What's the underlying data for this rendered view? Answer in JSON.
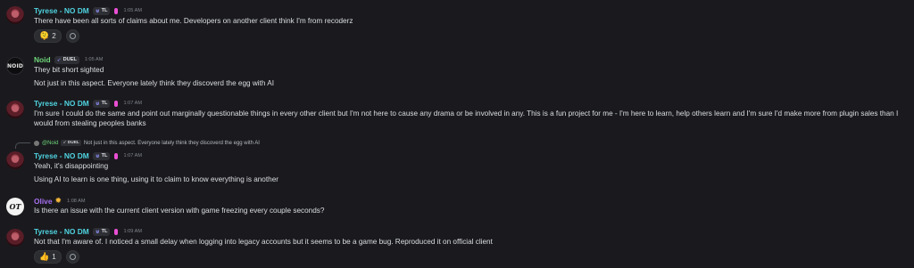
{
  "messages": [
    {
      "author": "Tyrese - NO DM",
      "tag": "TL",
      "time": "1:05 AM",
      "lines": [
        "There have been all sorts of claims about me. Developers on another client think I'm from recoderz"
      ],
      "reactions": [
        {
          "emoji": "🫠",
          "count": "2"
        }
      ]
    },
    {
      "author": "Noid",
      "avatar_text": "NOID",
      "tag": "DUEL",
      "time": "1:05 AM",
      "lines": [
        "They bit short sighted",
        "Not just in this aspect. Everyone lately think they discoverd the egg with AI"
      ]
    },
    {
      "author": "Tyrese - NO DM",
      "tag": "TL",
      "time": "1:07 AM",
      "lines": [
        "I'm sure I could do the same and point out marginally questionable things in every other client but I'm not here to cause any drama or be involved in any. This is a fun project for me - I'm here to learn, help others learn and I'm sure I'd make more from plugin sales than I would from stealing peoples banks"
      ]
    },
    {
      "reply": {
        "name": "@Noid",
        "tag": "DUEL",
        "text": "Not just in this aspect. Everyone lately think they discoverd the egg with AI"
      },
      "author": "Tyrese - NO DM",
      "tag": "TL",
      "time": "1:07 AM",
      "lines": [
        "Yeah, it's disappointing",
        "Using AI to learn is one thing, using it to claim to know everything is another"
      ]
    },
    {
      "author": "Olive",
      "avatar_text": "OT",
      "time": "1:08 AM",
      "lines": [
        "Is there an issue with the current client version with game freezing every couple seconds?"
      ]
    },
    {
      "author": "Tyrese - NO DM",
      "tag": "TL",
      "time": "1:09 AM",
      "lines": [
        "Not that I'm aware of. I noticed a small delay when logging into legacy accounts but it seems to be a game bug. Reproduced it on official client"
      ],
      "reactions": [
        {
          "emoji": "👍",
          "count": "1"
        }
      ]
    }
  ],
  "colors": {
    "background": "#1a1a1e",
    "tyrese_name": "#4fd3e0",
    "noid_name": "#6fd67a",
    "olive_name": "#a66ff0",
    "timestamp": "#80848e"
  }
}
